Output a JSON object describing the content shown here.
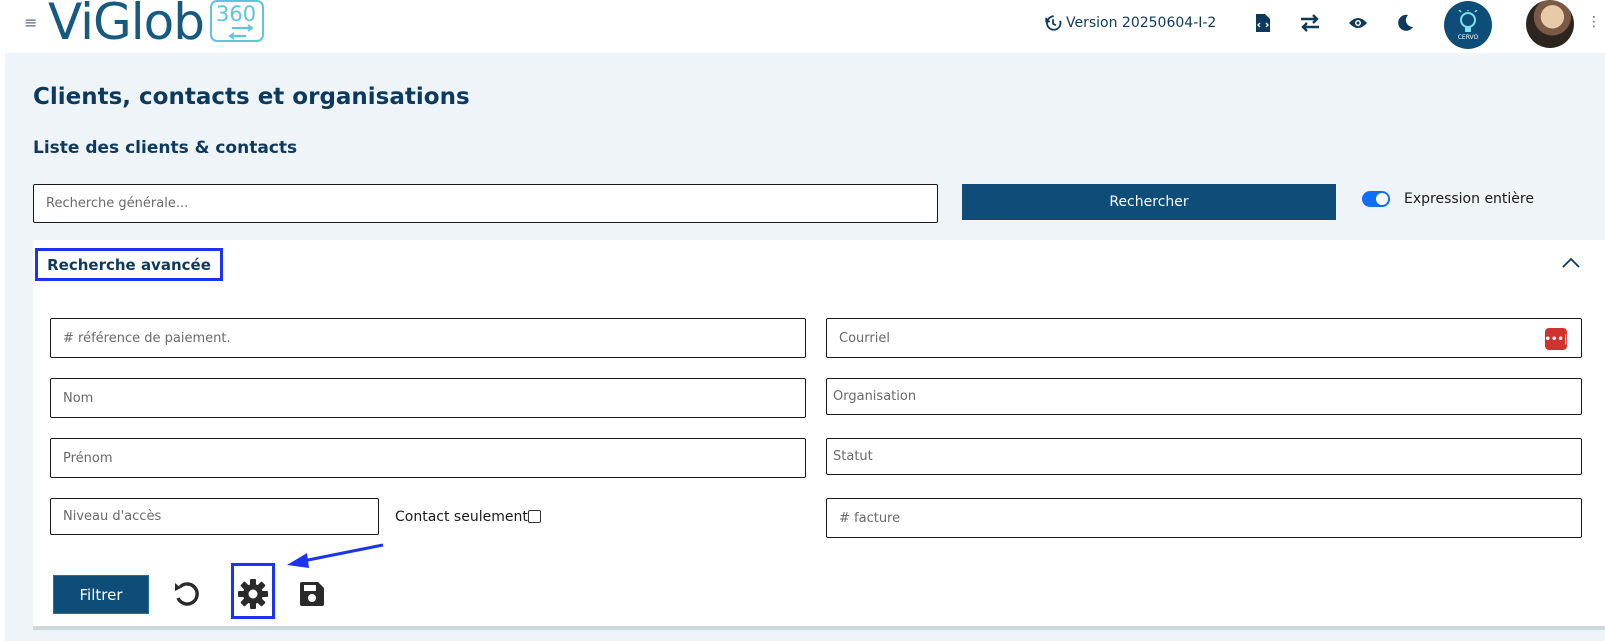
{
  "header": {
    "logo_text": "ViGlob",
    "logo_badge": "360",
    "version": "Version 20250604-I-2",
    "cervo_label": "CERVO"
  },
  "main": {
    "page_title": "Clients, contacts et organisations",
    "section_title": "Liste des clients & contacts",
    "search_placeholder": "Recherche générale...",
    "search_button": "Rechercher",
    "toggle_label": "Expression entière"
  },
  "advanced": {
    "title": "Recherche avancée",
    "fields": {
      "payment_ref": "# référence de paiement.",
      "email": "Courriel",
      "nom": "Nom",
      "organisation": "Organisation",
      "prenom": "Prénom",
      "statut": "Statut",
      "niveau": "Niveau d'accès",
      "facture": "# facture"
    },
    "contact_only_label": "Contact seulement",
    "filter_button": "Filtrer"
  },
  "colors": {
    "primary": "#0d4d78",
    "highlight": "#1b34f1",
    "background": "#eff4f9"
  }
}
